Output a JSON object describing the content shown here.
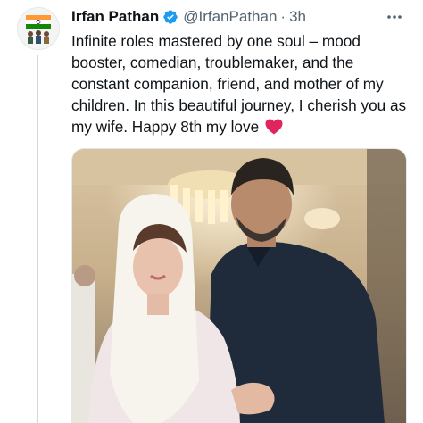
{
  "tweet": {
    "author_name": "Irfan Pathan",
    "handle": "@IrfanPathan",
    "separator": "·",
    "time": "3h",
    "text": "Infinite roles mastered by one soul – mood booster, comedian, troublemaker, and the constant companion, friend, and mother of my children. In this beautiful journey, I cherish you as my wife. Happy 8th my love",
    "emoji": "red-heart",
    "verified": true
  },
  "icons": {
    "verified": "verified-badge-icon",
    "more": "more-options-icon",
    "heart": "red-heart-emoji"
  },
  "colors": {
    "verified_blue": "#1d9bf0",
    "secondary_text": "#536471",
    "heart_red": "#e0245e"
  }
}
